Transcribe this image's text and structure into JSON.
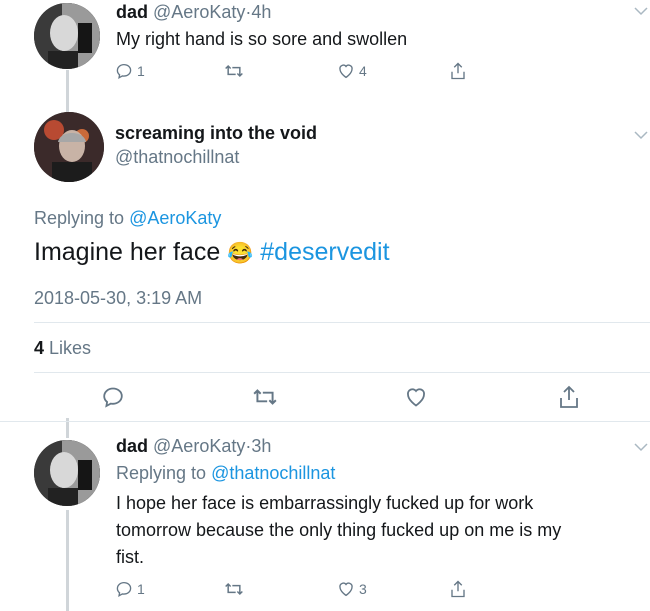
{
  "tweets": [
    {
      "name": "dad",
      "handle": "@AeroKaty",
      "time": "4h",
      "text": "My right hand is so sore and swollen",
      "replies": "1",
      "likes": "4"
    },
    {
      "name": "screaming into the void",
      "handle": "@thatnochillnat",
      "replying_label": "Replying to ",
      "replying_to": "@AeroKaty",
      "text": "Imagine her face",
      "emoji": "😂",
      "hashtag": "#deservedit",
      "timestamp": "2018-05-30, 3:19 AM",
      "likes_count": "4",
      "likes_label": "Likes"
    },
    {
      "name": "dad",
      "handle": "@AeroKaty",
      "time": "3h",
      "replying_label": "Replying to ",
      "replying_to": "@thatnochillnat",
      "text_line1": "I hope her face is embarrassingly fucked up for work",
      "text_line2": "tomorrow because the only thing fucked up on me is my",
      "text_line3": "fist.",
      "replies": "1",
      "likes": "3"
    }
  ],
  "separator": "·",
  "icons": [
    "reply-icon",
    "retweet-icon",
    "like-icon",
    "share-icon",
    "chevron-down-icon"
  ],
  "colors": {
    "link": "#1b95e0",
    "muted": "#657786",
    "divider": "#e1e8ed"
  }
}
